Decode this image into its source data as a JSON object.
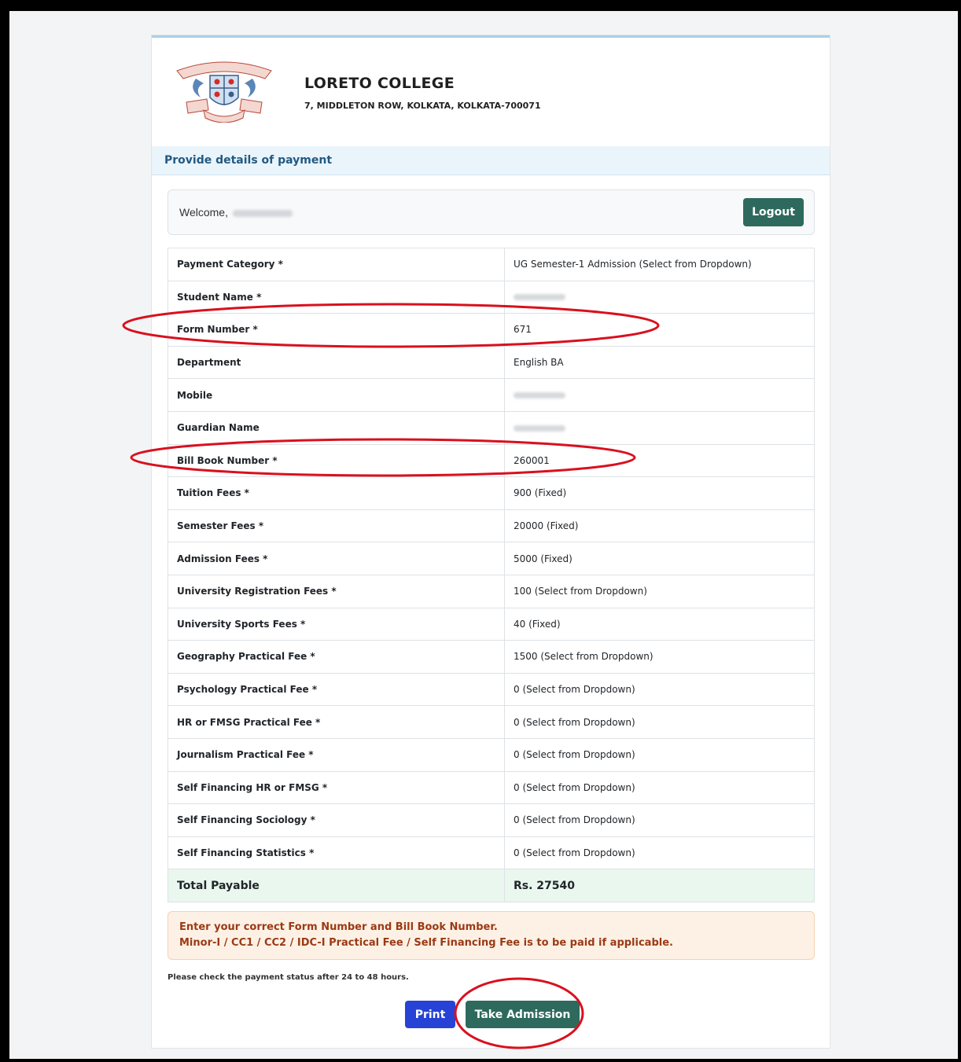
{
  "college": {
    "name": "LORETO COLLEGE",
    "address": "7, MIDDLETON ROW, KOLKATA, KOLKATA-700071"
  },
  "section": {
    "title": "Provide details of payment"
  },
  "welcome": {
    "text": "Welcome,",
    "logout_label": "Logout"
  },
  "rows": [
    {
      "label": "Payment Category *",
      "value": "UG Semester-1 Admission (Select from Dropdown)"
    },
    {
      "label": "Student Name *",
      "value": ""
    },
    {
      "label": "Form Number *",
      "value": "671"
    },
    {
      "label": "Department",
      "value": "English BA"
    },
    {
      "label": "Mobile",
      "value": ""
    },
    {
      "label": "Guardian Name",
      "value": ""
    },
    {
      "label": "Bill Book Number *",
      "value": "260001"
    },
    {
      "label": "Tuition Fees *",
      "value": "900 (Fixed)"
    },
    {
      "label": "Semester Fees *",
      "value": "20000 (Fixed)"
    },
    {
      "label": "Admission Fees *",
      "value": "5000 (Fixed)"
    },
    {
      "label": "University Registration Fees *",
      "value": "100 (Select from Dropdown)"
    },
    {
      "label": "University Sports Fees *",
      "value": "40 (Fixed)"
    },
    {
      "label": "Geography Practical Fee *",
      "value": "1500 (Select from Dropdown)"
    },
    {
      "label": "Psychology Practical Fee *",
      "value": "0 (Select from Dropdown)"
    },
    {
      "label": "HR or FMSG Practical Fee *",
      "value": "0 (Select from Dropdown)"
    },
    {
      "label": "Journalism Practical Fee *",
      "value": "0 (Select from Dropdown)"
    },
    {
      "label": "Self Financing HR or FMSG *",
      "value": "0 (Select from Dropdown)"
    },
    {
      "label": "Self Financing Sociology *",
      "value": "0 (Select from Dropdown)"
    },
    {
      "label": "Self Financing Statistics *",
      "value": "0 (Select from Dropdown)"
    }
  ],
  "total": {
    "label": "Total Payable",
    "value": "Rs. 27540"
  },
  "notice": {
    "line1": "Enter your correct Form Number and Bill Book Number.",
    "line2": "Minor-I / CC1 / CC2 / IDC-I Practical Fee / Self Financing Fee is to be paid if applicable."
  },
  "status_note": "Please check the payment status after 24 to 48 hours.",
  "buttons": {
    "print_label": "Print",
    "take_admission_label": "Take Admission"
  },
  "colors": {
    "primary_green": "#2d6a5d",
    "print_blue": "#2643d6",
    "section_title": "#225a82",
    "notice_text": "#9b3a14",
    "annotation_red": "#d9101e"
  }
}
